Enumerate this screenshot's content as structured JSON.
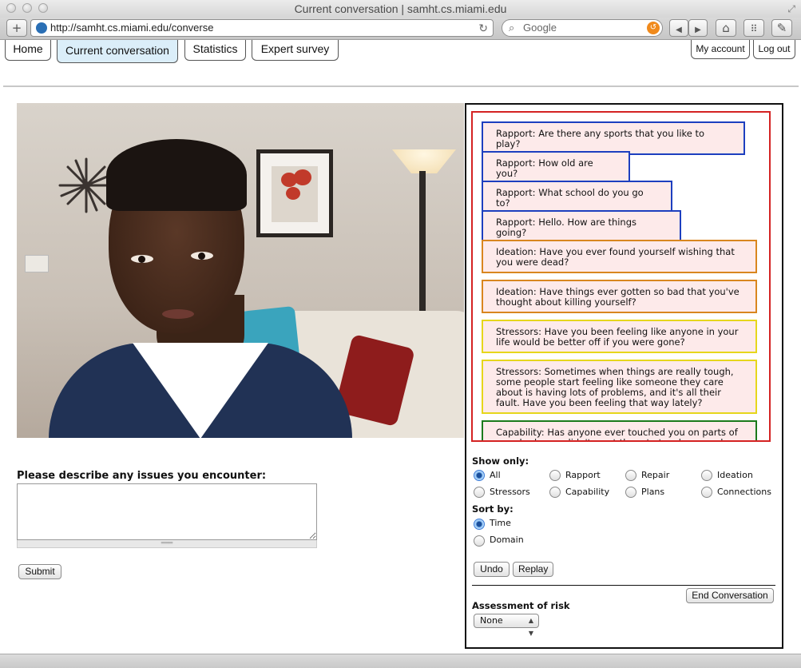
{
  "window": {
    "title": "Current conversation | samht.cs.miami.edu"
  },
  "toolbar": {
    "url": "http://samht.cs.miami.edu/converse",
    "search_placeholder": "Google"
  },
  "nav": {
    "tabs": [
      {
        "label": "Home"
      },
      {
        "label": "Current conversation",
        "active": true
      },
      {
        "label": "Statistics"
      },
      {
        "label": "Expert survey"
      }
    ],
    "my_account": "My account",
    "log_out": "Log out"
  },
  "issues": {
    "label": "Please describe any issues you encounter:",
    "value": "",
    "submit_label": "Submit"
  },
  "questions": [
    {
      "domain": "rapport",
      "text": "Rapport: Are there any sports that you like to play?"
    },
    {
      "domain": "rapport",
      "text": "Rapport: How old are you?"
    },
    {
      "domain": "rapport",
      "text": "Rapport: What school do you go to?"
    },
    {
      "domain": "rapport",
      "text": "Rapport: Hello. How are things going?"
    },
    {
      "domain": "ideation",
      "text": "Ideation: Have you ever found yourself wishing that you were dead?"
    },
    {
      "domain": "ideation",
      "text": "Ideation: Have things ever gotten so bad that you've thought about killing yourself?"
    },
    {
      "domain": "stressors",
      "text": "Stressors: Have you been feeling like anyone in your life would be better off if you were gone?"
    },
    {
      "domain": "stressors",
      "text": "Stressors: Sometimes when things are really tough, some people start feeling like someone they care about is having lots of problems, and it's all their fault. Have you been feeling that way lately?"
    },
    {
      "domain": "capability",
      "text": "Capability: Has anyone ever touched you on parts of your body you didn't want them to touch, or made"
    }
  ],
  "domain_colors": {
    "rapport": "#1d3fbf",
    "ideation": "#d9861f",
    "stressors": "#e6d61c",
    "capability": "#1c7a1c",
    "list_border": "#d42323"
  },
  "filters": {
    "show_only_label": "Show only:",
    "options": [
      "All",
      "Rapport",
      "Repair",
      "Ideation",
      "Stressors",
      "Capability",
      "Plans",
      "Connections"
    ],
    "selected": "All",
    "sort_by_label": "Sort by:",
    "sort_options": [
      "Time",
      "Domain"
    ],
    "sort_selected": "Time"
  },
  "actions": {
    "undo": "Undo",
    "replay": "Replay",
    "end_conversation": "End Conversation"
  },
  "assessment": {
    "label": "Assessment of risk",
    "selected": "None"
  }
}
